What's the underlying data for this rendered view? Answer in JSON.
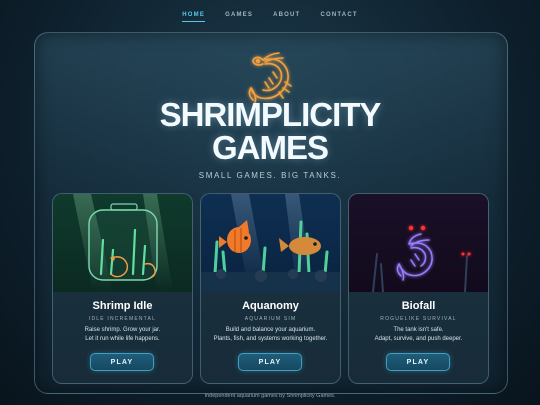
{
  "nav": {
    "items": [
      "HOME",
      "GAMES",
      "ABOUT",
      "CONTACT"
    ],
    "active": "HOME"
  },
  "hero": {
    "title_line1": "SHRIMPLICITY",
    "title_line2": "GAMES",
    "tagline": "SMALL GAMES. BIG TANKS."
  },
  "games": [
    {
      "name": "Shrimp Idle",
      "genre": "IDLE INCREMENTAL",
      "desc_line1": "Raise shrimp. Grow your jar.",
      "desc_line2": "Let it run while life happens.",
      "button": "PLAY"
    },
    {
      "name": "Aquanomy",
      "genre": "AQUARIUM SIM",
      "desc_line1": "Build and balance your aquarium.",
      "desc_line2": "Plants, fish, and systems working together.",
      "button": "PLAY"
    },
    {
      "name": "Biofall",
      "genre": "ROGUELIKE SURVIVAL",
      "desc_line1": "The tank isn't safe.",
      "desc_line2": "Adapt, survive, and push deeper.",
      "button": "PLAY"
    }
  ],
  "footer": "Independent aquarium games by Shrimplicity Games.",
  "colors": {
    "accent": "#58c8e8",
    "shrimp_orange": "#f0a040",
    "biofall_purple": "#9a7cff",
    "biofall_eyes": "#ff3030"
  },
  "icons": [
    "shrimp-logo-icon",
    "shrimp-jar-icon",
    "fish-icon",
    "neon-shrimp-icon"
  ]
}
